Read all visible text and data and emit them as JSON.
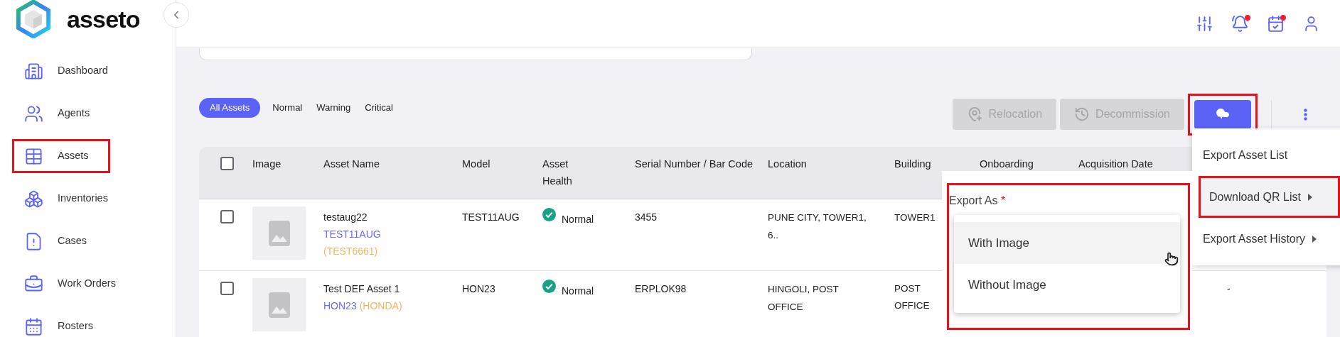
{
  "brand": {
    "name": "asseto"
  },
  "header_icons": [
    {
      "dot": false
    },
    {
      "dot": true
    },
    {
      "dot": true
    },
    {
      "dot": false
    }
  ],
  "sidebar": {
    "items": [
      {
        "label": "Dashboard",
        "annotated": false
      },
      {
        "label": "Agents",
        "annotated": false
      },
      {
        "label": "Assets",
        "annotated": true
      },
      {
        "label": "Inventories",
        "annotated": false
      },
      {
        "label": "Cases",
        "annotated": false
      },
      {
        "label": "Work Orders",
        "annotated": false
      },
      {
        "label": "Rosters",
        "annotated": false
      }
    ]
  },
  "filters": [
    {
      "label": "All Assets",
      "selected": true
    },
    {
      "label": "Normal",
      "selected": false
    },
    {
      "label": "Warning",
      "selected": false
    },
    {
      "label": "Critical",
      "selected": false
    }
  ],
  "actions": [
    {
      "label": "Relocation",
      "disabled": true
    },
    {
      "label": "Decommission",
      "disabled": true
    }
  ],
  "download_button": {
    "annotated": true
  },
  "table": {
    "all_checked": false,
    "columns": [
      "Image",
      "Asset Name",
      "Model",
      "Asset Health",
      "Serial Number / Bar Code",
      "Location",
      "Building",
      "Onboarding",
      "Acquisition Date"
    ],
    "rows": [
      {
        "checked": false,
        "name": "testaug22",
        "model_tag": "TEST11AUG",
        "brand_tag": "(TEST6661)",
        "model": "TEST11AUG",
        "health": "Normal",
        "serial": "3455",
        "location": "PUNE CITY, TOWER1, 6..",
        "building": "TOWER1"
      },
      {
        "checked": false,
        "name": "Test DEF Asset 1",
        "model_tag": "HON23",
        "brand_tag": "(HONDA)",
        "model": "HON23",
        "health": "Normal",
        "serial": "ERPLOK98",
        "location": "HINGOLI, POST OFFICE",
        "building": "POST OFFICE",
        "column_10": "-"
      }
    ]
  },
  "export_menu": {
    "items": [
      {
        "label": "Export Asset List",
        "submenu": false,
        "selected": false,
        "annotated": false
      },
      {
        "label": "Download QR List",
        "submenu": true,
        "selected": true,
        "annotated": true
      },
      {
        "label": "Export Asset History",
        "submenu": true,
        "selected": false,
        "annotated": false
      }
    ]
  },
  "export_as": {
    "label": "Export As",
    "required_mark": "*",
    "annotated": true,
    "options": [
      {
        "label": "With Image",
        "selected": true
      },
      {
        "label": "Without Image",
        "selected": false
      }
    ]
  }
}
